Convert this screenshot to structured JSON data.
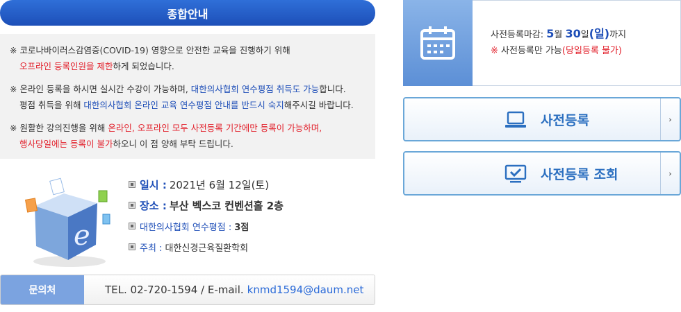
{
  "info": {
    "title": "종합안내"
  },
  "notices": [
    {
      "line1": "※ 코로나바이러스감염증(COVID-19) 영향으로 안전한 교육을 진행하기 위해",
      "line2_red": "오프라인 등록인원을 제한",
      "line2_rest": "하게 되었습니다."
    },
    {
      "line1_a": "※ 온라인 등록을 하시면 실시간 수강이 가능하며, ",
      "line1_blue": "대한의사협회 연수평점 취득도 가능",
      "line1_b": "합니다.",
      "line2_a": "평점 취득을 위해 ",
      "line2_blue": "대한의사협회 온라인 교육 연수평점 안내를 반드시 숙지",
      "line2_b": "해주시길 바랍니다."
    },
    {
      "line1_a": "※ 원활한 강의진행을 위해 ",
      "line1_red": "온라인, 오프라인 모두 사전등록 기간에만 등록이 가능하며,",
      "line2_red": "행사당일에는 등록이 불가",
      "line2_rest": "하오니 이 점 양해 부탁 드립니다."
    }
  ],
  "event": {
    "date_label": "일시 :",
    "date_value": "2021년 6월 12일(토)",
    "place_label": "장소 :",
    "place_value": "부산 벡스코 컨벤션홀 2층",
    "credit_label": "대한의사협회 연수평점 :",
    "credit_value": "3점",
    "host_label": "주최 :",
    "host_value": "대한신경근육질환학회"
  },
  "contact": {
    "label": "문의처",
    "tel": "TEL. 02-720-1594 / E-mail.",
    "email": "knmd1594@daum.net"
  },
  "deadline": {
    "prefix": "사전등록마감: ",
    "month": "5",
    "month_unit": "월 ",
    "day": "30",
    "day_unit": "일",
    "weekday": "(일)",
    "suffix": "까지",
    "note_mark": "※",
    "note_text": " 사전등록만 가능",
    "note_red": "(당일등록 불가)"
  },
  "buttons": {
    "register": "사전등록",
    "lookup": "사전등록 조회",
    "arrow": "›"
  },
  "colors": {
    "accent": "#2f6fd8",
    "red": "#e21f2a",
    "button_border": "#6aa7d8"
  },
  "icons": {
    "calendar": "calendar-icon",
    "laptop": "laptop-icon",
    "check": "check-monitor-icon",
    "cube": "e-learning-cube-icon"
  }
}
